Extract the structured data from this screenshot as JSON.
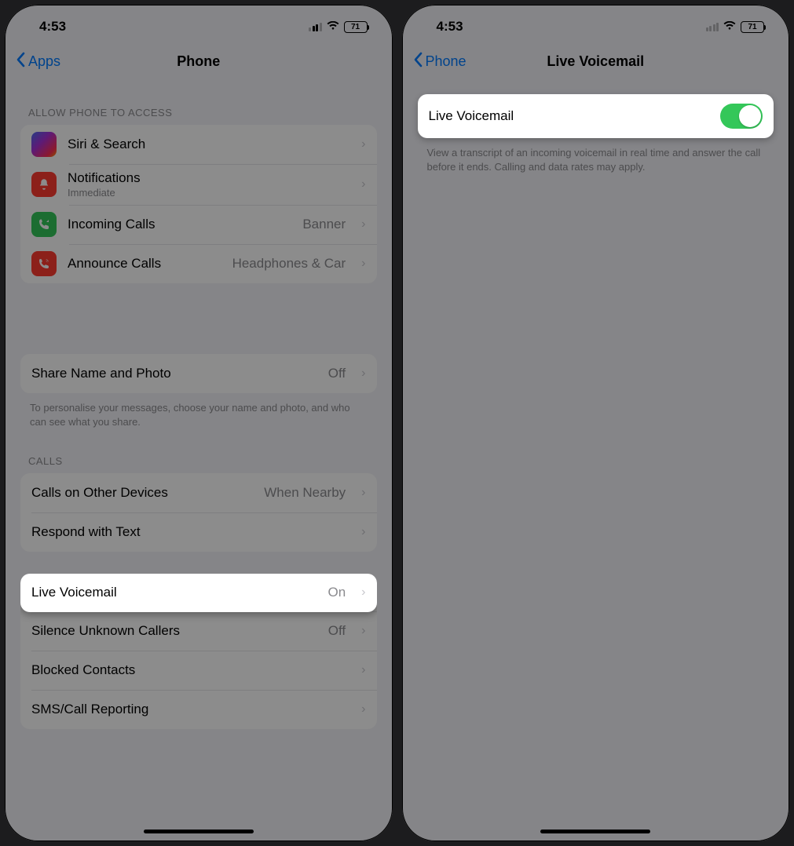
{
  "status": {
    "time": "4:53",
    "battery": "71"
  },
  "left": {
    "back_label": "Apps",
    "title": "Phone",
    "access_header": "ALLOW PHONE TO ACCESS",
    "access": [
      {
        "label": "Siri & Search",
        "sublabel": "",
        "detail": "",
        "icon": "siri"
      },
      {
        "label": "Notifications",
        "sublabel": "Immediate",
        "detail": "",
        "icon": "notif"
      },
      {
        "label": "Incoming Calls",
        "sublabel": "",
        "detail": "Banner",
        "icon": "incom"
      },
      {
        "label": "Announce Calls",
        "sublabel": "",
        "detail": "Headphones & Car",
        "icon": "annc"
      }
    ],
    "share": {
      "label": "Share Name and Photo",
      "detail": "Off",
      "footer": "To personalise your messages, choose your name and photo, and who can see what you share."
    },
    "calls_header": "CALLS",
    "calls": [
      {
        "label": "Calls on Other Devices",
        "detail": "When Nearby"
      },
      {
        "label": "Respond with Text",
        "detail": ""
      }
    ],
    "calls2": [
      {
        "label": "Live Voicemail",
        "detail": "On"
      },
      {
        "label": "Silence Unknown Callers",
        "detail": "Off"
      },
      {
        "label": "Blocked Contacts",
        "detail": ""
      },
      {
        "label": "SMS/Call Reporting",
        "detail": ""
      }
    ]
  },
  "right": {
    "back_label": "Phone",
    "title": "Live Voicemail",
    "toggle_label": "Live Voicemail",
    "toggle_on": true,
    "footer": "View a transcript of an incoming voicemail in real time and answer the call before it ends. Calling and data rates may apply."
  }
}
